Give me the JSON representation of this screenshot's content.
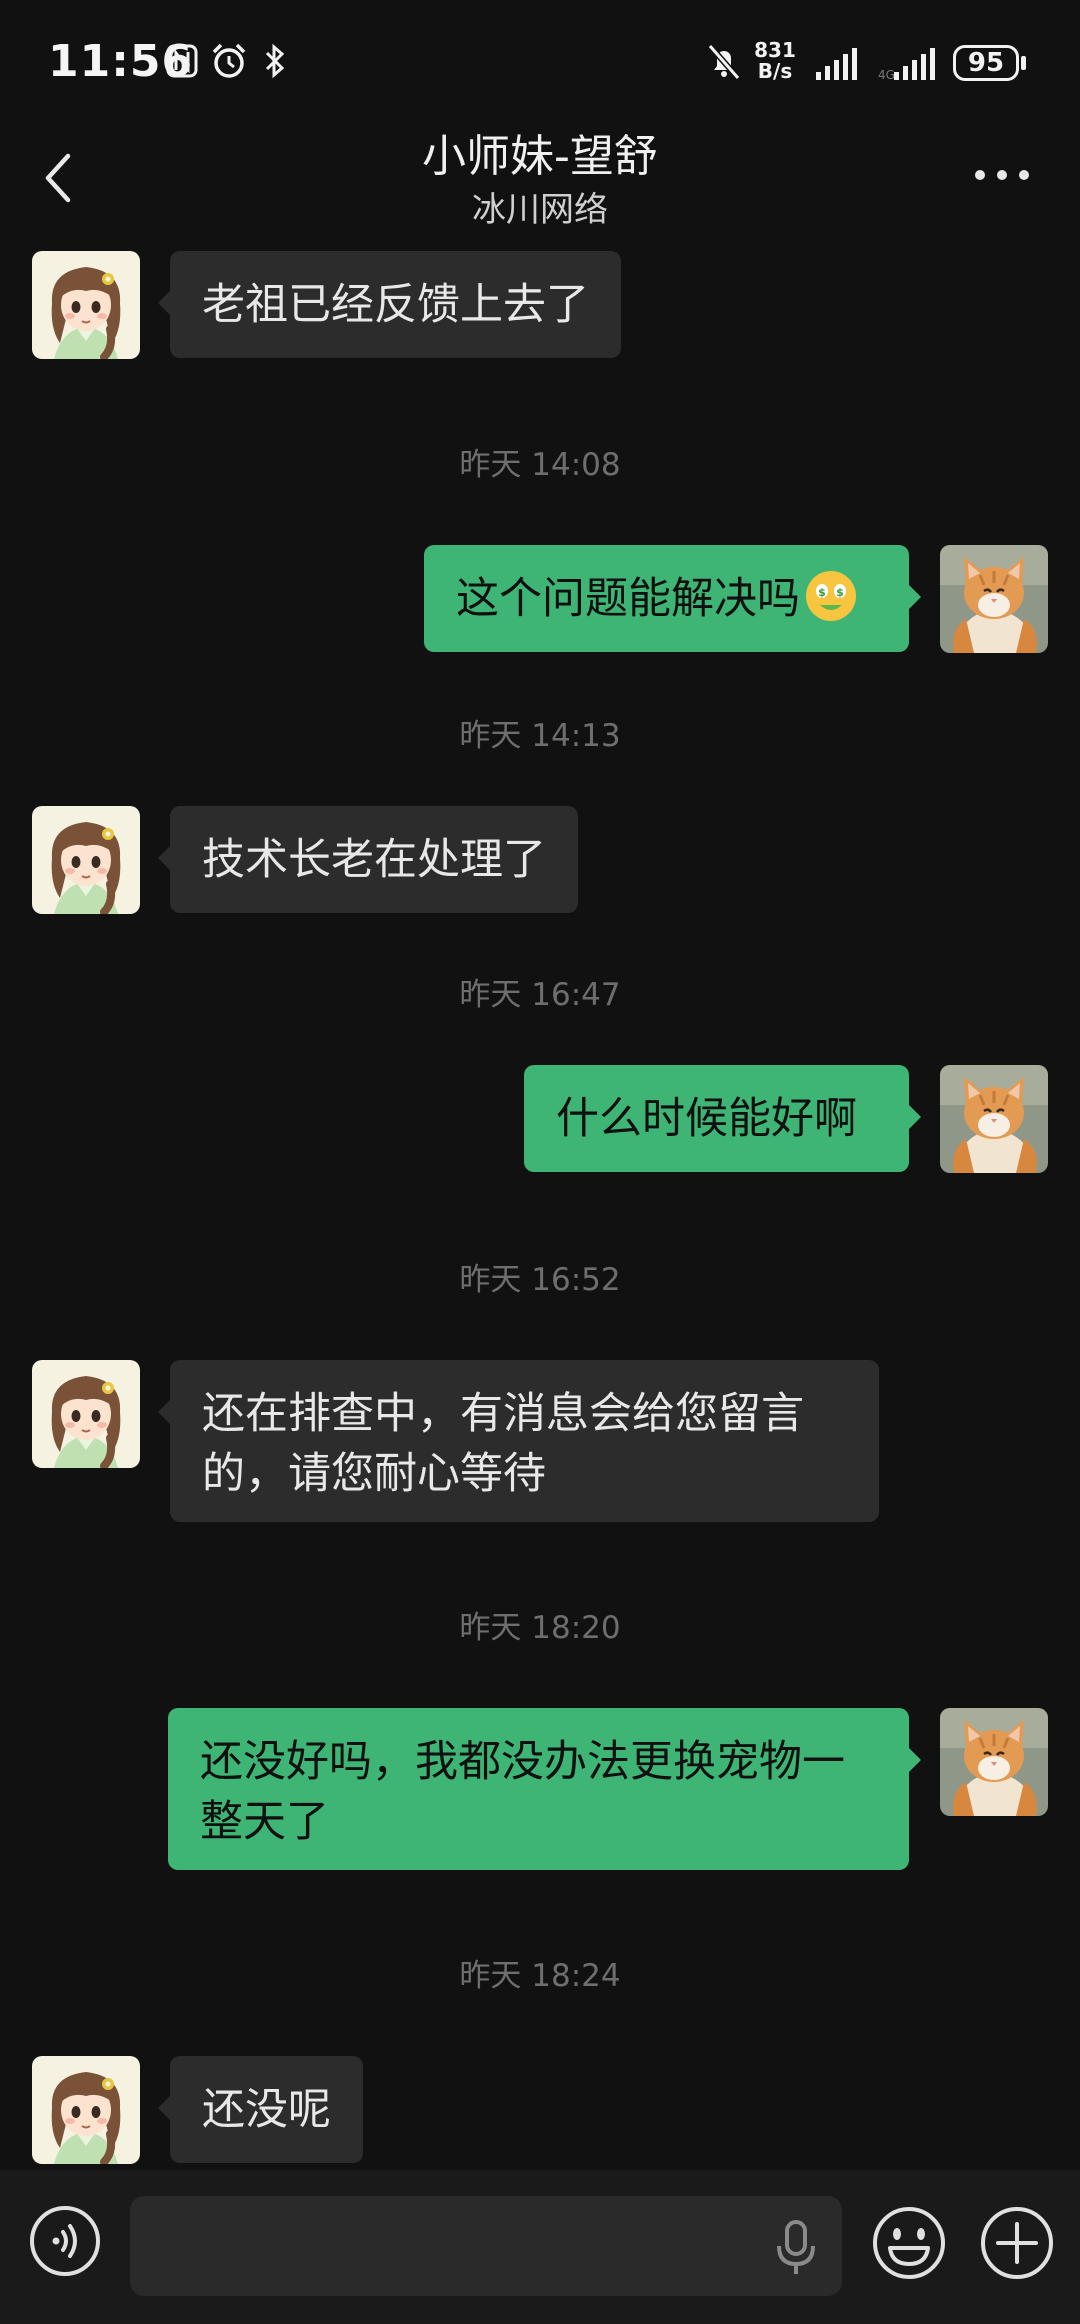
{
  "status_bar": {
    "time": "11:56",
    "net_speed_value": "831",
    "net_speed_unit": "B/s",
    "battery": "95",
    "icons": [
      "nfc-icon",
      "alarm-icon",
      "bluetooth-icon",
      "mute-icon",
      "signal-icon",
      "signal-icon-2"
    ]
  },
  "header": {
    "title": "小师妹-望舒",
    "subtitle": "冰川网络",
    "back_icon": "chevron-left-icon",
    "more_icon": "more-horizontal-icon"
  },
  "chat": {
    "messages": [
      {
        "side": "in",
        "text": "老祖已经反馈上去了"
      },
      {
        "timestamp": "昨天 14:08"
      },
      {
        "side": "out",
        "text": "这个问题能解决吗",
        "emoji": "money-mouth-face"
      },
      {
        "timestamp": "昨天 14:13"
      },
      {
        "side": "in",
        "text": "技术长老在处理了"
      },
      {
        "timestamp": "昨天 16:47"
      },
      {
        "side": "out",
        "text": "什么时候能好啊"
      },
      {
        "timestamp": "昨天 16:52"
      },
      {
        "side": "in",
        "text_line1": "还在排查中，有消息会给您留言",
        "text_line2": "的，请您耐心等待"
      },
      {
        "timestamp": "昨天 18:20"
      },
      {
        "side": "out",
        "text_line1": "还没好吗，我都没办法更换宠物一",
        "text_line2": "整天了"
      },
      {
        "timestamp": "昨天 18:24"
      },
      {
        "side": "in",
        "text": "还没呢"
      }
    ]
  },
  "input_bar": {
    "message_value": "",
    "icons": [
      "voice-icon",
      "mic-icon",
      "emoji-icon",
      "add-icon"
    ]
  },
  "colors": {
    "background": "#111111",
    "incoming_bubble": "#2c2c2c",
    "outgoing_bubble": "#3eb575",
    "timestamp": "#6e6e6e"
  }
}
